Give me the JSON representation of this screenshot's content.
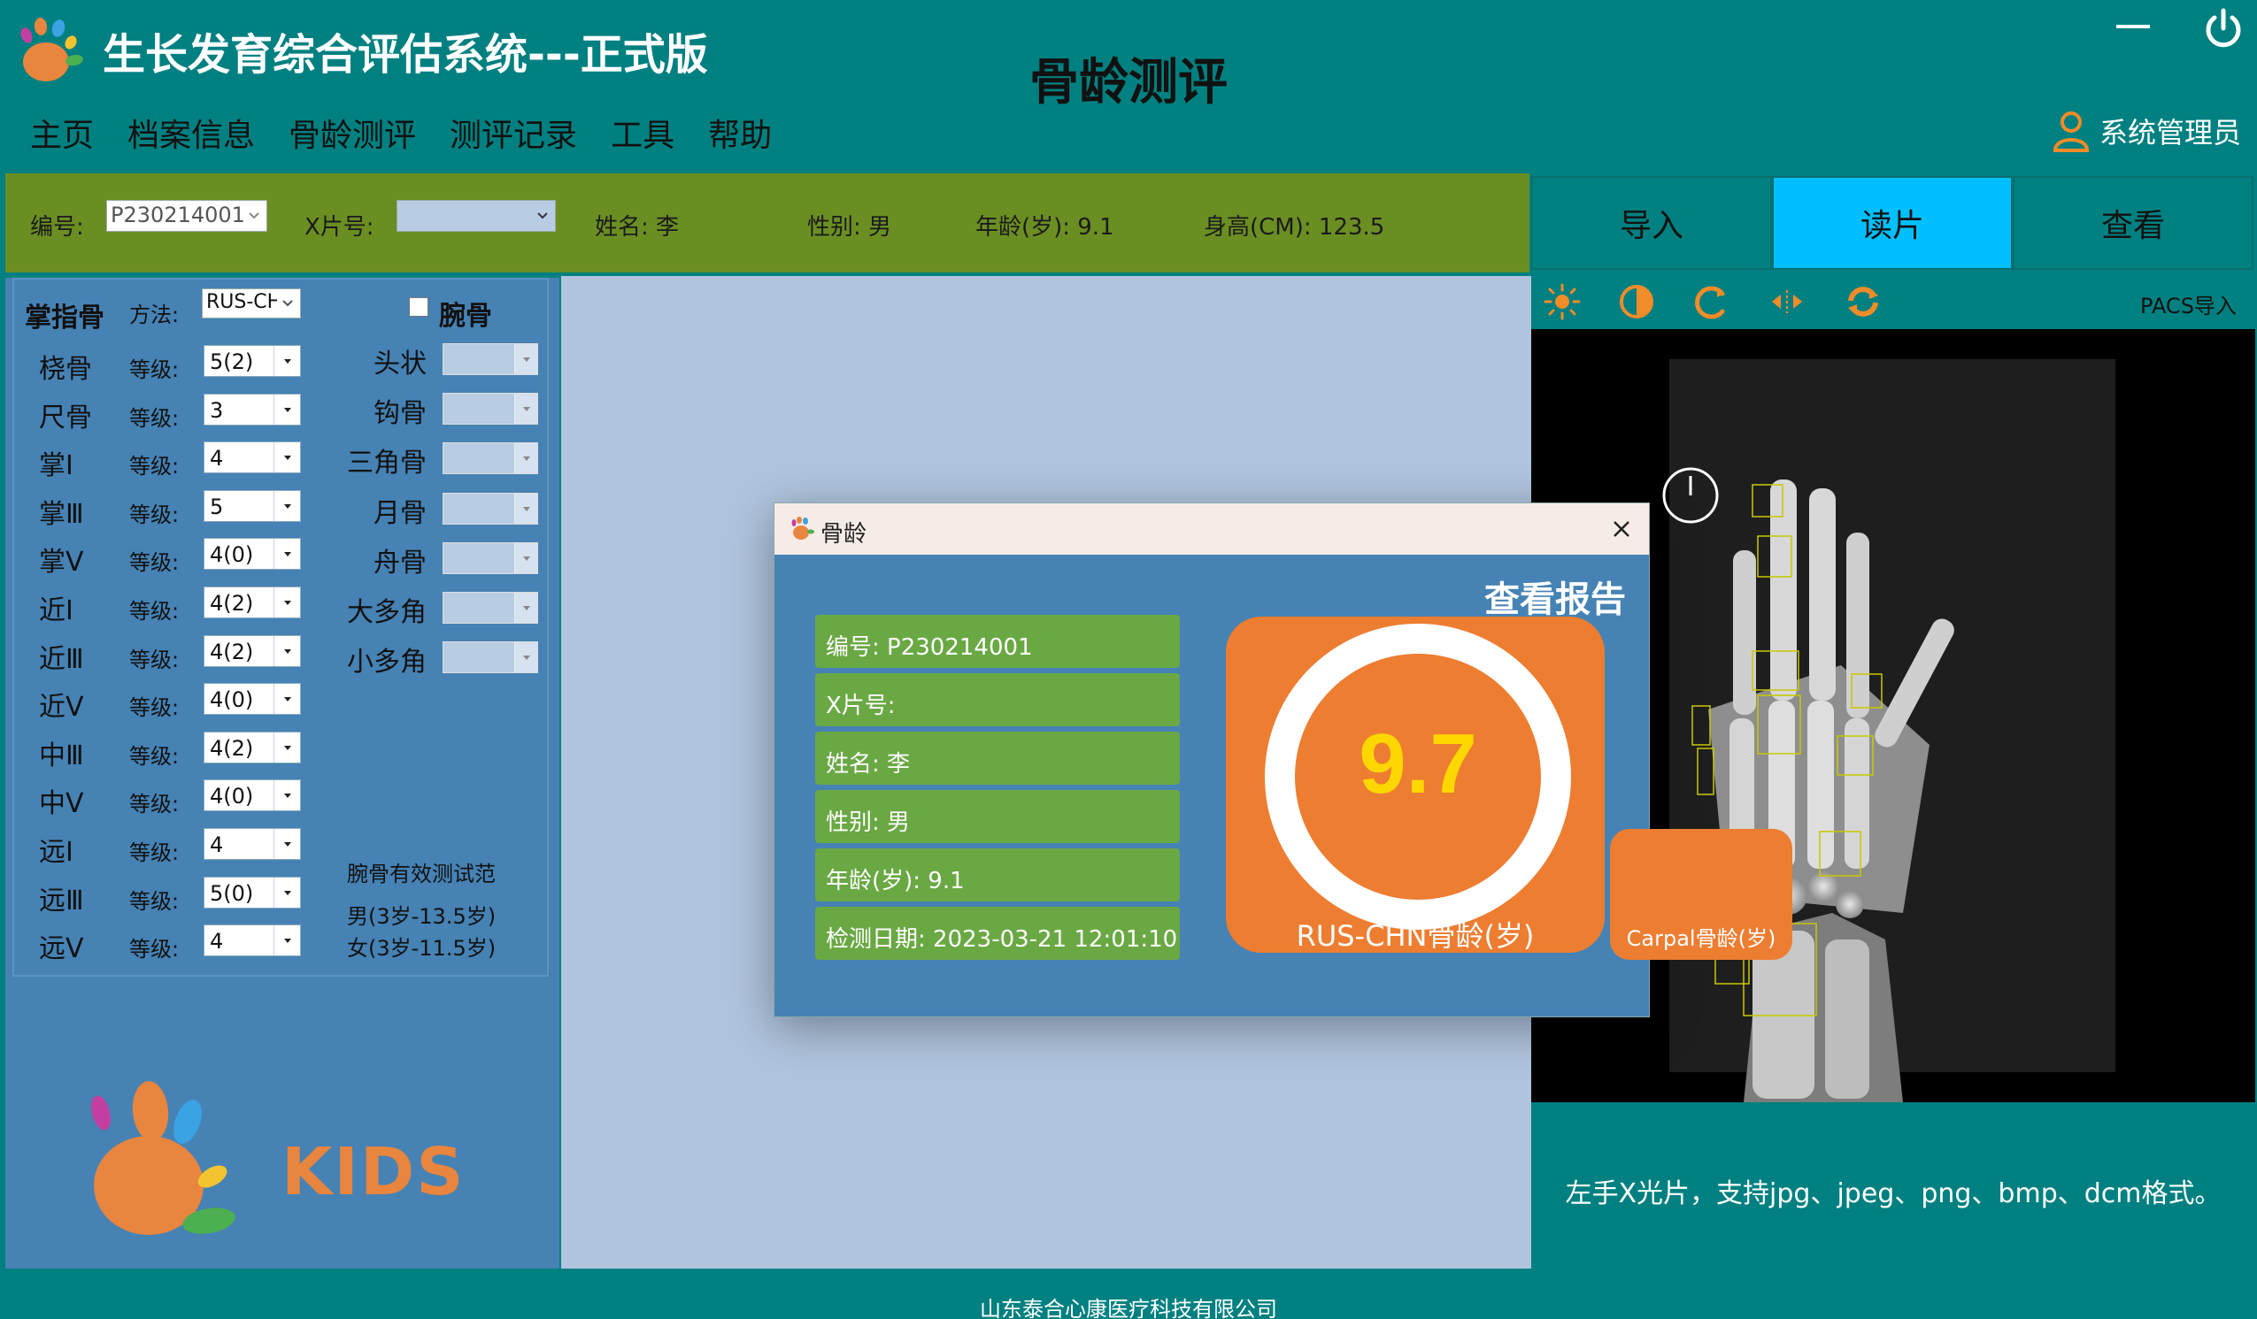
{
  "app": {
    "title": "生长发育综合评估系统---正式版",
    "page_title": "骨龄测评",
    "menu": [
      "主页",
      "档案信息",
      "骨龄测评",
      "测评记录",
      "工具",
      "帮助"
    ],
    "user": "系统管理员"
  },
  "info_bar": {
    "id_label": "编号:",
    "id_value": "P230214001",
    "xray_label": "X片号:",
    "xray_value": "",
    "name_label": "姓名: 李",
    "gender_label": "性别: 男",
    "age_label": "年龄(岁): 9.1",
    "height_label": "身高(CM): 123.5"
  },
  "action_buttons": [
    "导入",
    "读片",
    "查看"
  ],
  "action_active_index": 1,
  "left_panel": {
    "title": "掌指骨",
    "method_label": "方法:",
    "method_value": "RUS-CH",
    "grade_label": "等级:",
    "bones": [
      {
        "name": "桡骨",
        "grade": "5(2)"
      },
      {
        "name": "尺骨",
        "grade": "3"
      },
      {
        "name": "掌Ⅰ",
        "grade": "4"
      },
      {
        "name": "掌Ⅲ",
        "grade": "5"
      },
      {
        "name": "掌Ⅴ",
        "grade": "4(0)"
      },
      {
        "name": "近Ⅰ",
        "grade": "4(2)"
      },
      {
        "name": "近Ⅲ",
        "grade": "4(2)"
      },
      {
        "name": "近Ⅴ",
        "grade": "4(0)"
      },
      {
        "name": "中Ⅲ",
        "grade": "4(2)"
      },
      {
        "name": "中Ⅴ",
        "grade": "4(0)"
      },
      {
        "name": "远Ⅰ",
        "grade": "4"
      },
      {
        "name": "远Ⅲ",
        "grade": "5(0)"
      },
      {
        "name": "远Ⅴ",
        "grade": "4"
      }
    ],
    "carpal_title": "腕骨",
    "carpal_bones": [
      "头状",
      "钩骨",
      "三角骨",
      "月骨",
      "舟骨",
      "大多角",
      "小多角"
    ],
    "carpal_note_title": "腕骨有效测试范",
    "carpal_note_male": "男(3岁-13.5岁)",
    "carpal_note_female": "女(3岁-11.5岁)",
    "kids_text": "KIDS"
  },
  "right_panel": {
    "pacs_import": "PACS导入",
    "hint": "左手X光片，支持jpg、jpeg、png、bmp、dcm格式。",
    "tool_icons": [
      "brightness-icon",
      "contrast-icon",
      "rotate-icon",
      "flip-horizontal-icon",
      "reset-icon"
    ]
  },
  "dialog": {
    "title": "骨龄",
    "view_report": "查看报告",
    "rows": [
      "编号: P230214001",
      "X片号:",
      "姓名: 李",
      "性别: 男",
      "年龄(岁): 9.1",
      "检测日期: 2023-03-21 12:01:10"
    ],
    "score_value": "9.7",
    "score_label": "RUS-CHN骨龄(岁)",
    "carpal_label": "Carpal骨龄(岁)"
  },
  "footer": {
    "company": "山东泰合心康医疗科技有限公司"
  },
  "colors": {
    "teal": "#008080",
    "olive": "#6b8e23",
    "steel_blue": "#4682b4",
    "light_steel": "#b0c4de",
    "active_button": "#00bfff",
    "orange": "#ed7d31",
    "score_yellow": "#ffd700",
    "row_green": "#6aa844"
  }
}
